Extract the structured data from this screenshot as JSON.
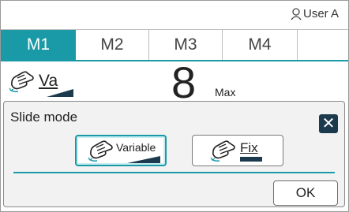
{
  "header": {
    "user_label": "User A",
    "user_icon": "user-icon"
  },
  "tabs": [
    {
      "label": "M1",
      "active": true
    },
    {
      "label": "M2",
      "active": false
    },
    {
      "label": "M3",
      "active": false
    },
    {
      "label": "M4",
      "active": false
    }
  ],
  "main": {
    "mode_button_label": "Va",
    "mode_icon": "slide-hand-icon",
    "big_value": "8",
    "max_label": "Max"
  },
  "dialog": {
    "title": "Slide mode",
    "close_icon": "close-icon",
    "options": [
      {
        "label": "Variable",
        "icon": "slide-hand-icon",
        "selected": true
      },
      {
        "label": "Fix",
        "icon": "slide-hand-icon",
        "selected": false
      }
    ],
    "ok_label": "OK"
  },
  "colors": {
    "accent": "#1a9aa7",
    "close_bg": "#1c3a4d",
    "dialog_bg": "#f2f2f2"
  }
}
